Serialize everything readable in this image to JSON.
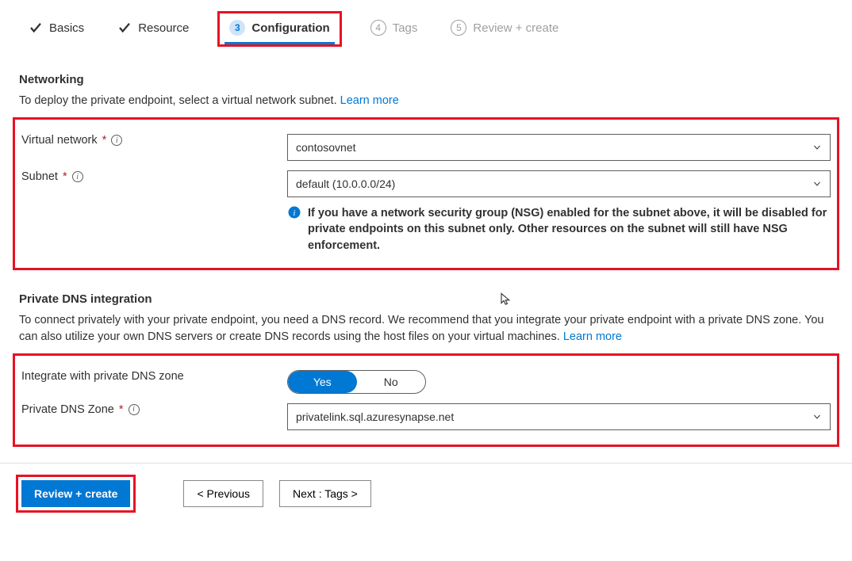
{
  "tabs": {
    "basics": "Basics",
    "resource": "Resource",
    "configuration": "Configuration",
    "config_num": "3",
    "tags_num": "4",
    "tags": "Tags",
    "review_num": "5",
    "review": "Review + create"
  },
  "networking": {
    "heading": "Networking",
    "desc": "To deploy the private endpoint, select a virtual network subnet.  ",
    "learn": "Learn more",
    "vnet_label": "Virtual network",
    "vnet_value": "contosovnet",
    "subnet_label": "Subnet",
    "subnet_value": "default (10.0.0.0/24)",
    "nsg_note": "If you have a network security group (NSG) enabled for the subnet above, it will be disabled for private endpoints on this subnet only. Other resources on the subnet will still have NSG enforcement."
  },
  "dns": {
    "heading": "Private DNS integration",
    "desc": "To connect privately with your private endpoint, you need a DNS record. We recommend that you integrate your private endpoint with a private DNS zone. You can also utilize your own DNS servers or create DNS records using the host files on your virtual machines.  ",
    "learn": "Learn more",
    "integrate_label": "Integrate with private DNS zone",
    "yes": "Yes",
    "no": "No",
    "zone_label": "Private DNS Zone",
    "zone_value": "privatelink.sql.azuresynapse.net"
  },
  "footer": {
    "review": "Review + create",
    "prev": "< Previous",
    "next": "Next : Tags >"
  }
}
